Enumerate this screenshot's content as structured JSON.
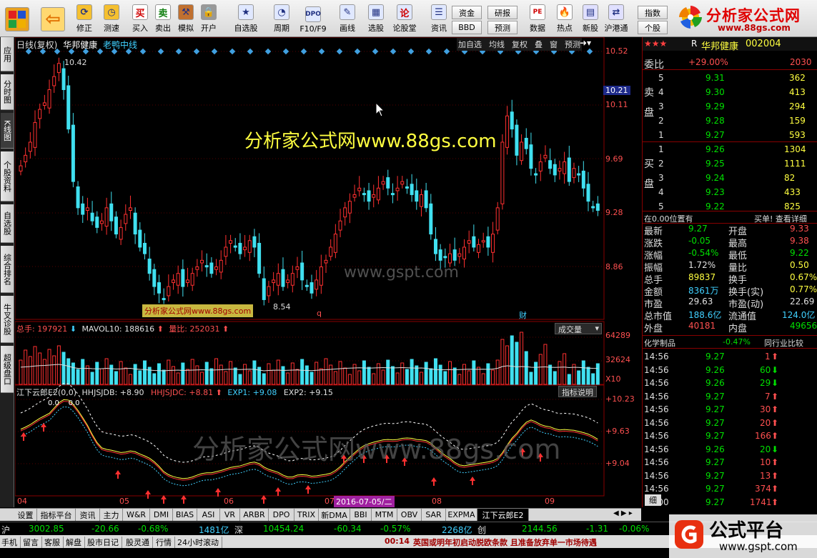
{
  "toolbar": {
    "buttons": [
      {
        "label": "",
        "icon": "grid-app-icon"
      },
      {
        "label": "",
        "icon": "back-arrow-icon"
      },
      {
        "label": "修正",
        "icon": "refresh-icon"
      },
      {
        "label": "测速",
        "icon": "clock-icon"
      },
      {
        "label": "买入",
        "icon": "buy-icon",
        "glyph": "买"
      },
      {
        "label": "卖出",
        "icon": "sell-icon",
        "glyph": "卖"
      },
      {
        "label": "模拟",
        "icon": "hammer-icon"
      },
      {
        "label": "开户",
        "icon": "lock-icon"
      },
      {
        "label": "自选股",
        "icon": "star-icon"
      },
      {
        "label": "周期",
        "icon": "cycle-icon"
      },
      {
        "label": "F10/F9",
        "icon": "f10-icon",
        "glyph": "DPO"
      },
      {
        "label": "画线",
        "icon": "pencil-icon"
      },
      {
        "label": "选股",
        "icon": "stock-pick-icon"
      },
      {
        "label": "论股堂",
        "icon": "forum-icon",
        "glyph": "论"
      },
      {
        "label": "资讯",
        "icon": "news-icon"
      },
      {
        "label": "数据",
        "icon": "pe-data-icon",
        "glyph": "PE"
      },
      {
        "label": "热点",
        "icon": "hot-icon"
      },
      {
        "label": "新股",
        "icon": "ipo-icon"
      },
      {
        "label": "沪港通",
        "icon": "sse-hkex-icon"
      }
    ],
    "small_buttons": [
      "资金",
      "研报",
      "BBD",
      "预测",
      "指数",
      "个股"
    ]
  },
  "logo": {
    "title": "分析家公式网",
    "url": "www.88gs.com"
  },
  "left_tabs": [
    "应用",
    "分时图",
    "K线图",
    "个股资料",
    "自选股",
    "综合排名",
    "牛叉诊股",
    "超级盘口"
  ],
  "chart": {
    "header": {
      "mode": "日线(复权)",
      "stock": "华邦健康",
      "indicator": "老鸭中线"
    },
    "header_buttons": [
      "加自选",
      "均线",
      "复权",
      "叠",
      "窗",
      "预测"
    ],
    "price_axis": [
      "10.52",
      "10.11",
      "9.69",
      "9.28",
      "8.86"
    ],
    "current_price_label": "10.21",
    "high_label": "10.42",
    "low_label": "8.54",
    "watermark_main": "分析家公式网www.88gs.com",
    "watermark_gspt": "www.gspt.com",
    "badge": "分析家公式网www.88gs.com",
    "marker_q": "q",
    "marker_cai": "财",
    "volume": {
      "total_label": "总手:",
      "total_value": "197921",
      "mavol_label": "MAVOL10:",
      "mavol_value": "188616",
      "ratio_label": "量比:",
      "ratio_value": "252031",
      "dropdown": "成交量",
      "axis": [
        "64289",
        "32624",
        "X10"
      ]
    },
    "indicator": {
      "name": "江下云郎E2(0,0)",
      "hh_label": "HHJSJDB:",
      "hh_value": "+8.90",
      "hhc_label": "HHJSJDC:",
      "hhc_value": "+8.81",
      "exp1_label": "EXP1:",
      "exp1_value": "+9.08",
      "exp2_label": "EXP2:",
      "exp2_value": "+9.15",
      "button": "指标说明",
      "axis": [
        "+10.23",
        "+9.63",
        "+9.04"
      ],
      "zero_labels": "0.0    0.0",
      "watermark": "分析家公式网www.88gs.com"
    },
    "dates": [
      "04",
      "05",
      "06",
      "07",
      "08",
      "09"
    ],
    "date_cursor": "2016-07-05/二"
  },
  "chart_data": {
    "type": "candlestick",
    "title": "华邦健康",
    "ylim": [
      8.45,
      10.6
    ],
    "x": [
      "04",
      "05",
      "06",
      "07",
      "08",
      "09"
    ],
    "series": [
      {
        "name": "price",
        "values": [
          9.62,
          9.7,
          9.8,
          9.95,
          10.05,
          10.1,
          10.2,
          10.3,
          10.4,
          10.2,
          9.9,
          9.5,
          9.3,
          9.25,
          9.3,
          9.2,
          9.15,
          9.2,
          9.3,
          9.2,
          9.1,
          9.15,
          9.25,
          9.3,
          9.1,
          9.0,
          8.95,
          8.8,
          8.7,
          8.65,
          8.6,
          8.7,
          8.75,
          8.8,
          8.7,
          8.75,
          8.8,
          8.85,
          8.9,
          8.85,
          8.8,
          8.85,
          8.9,
          9.0,
          9.05,
          9.0,
          8.95,
          9.0,
          9.05,
          9.0,
          8.8,
          8.6,
          8.7,
          8.75,
          8.8,
          8.7,
          8.75,
          8.8,
          8.85,
          8.75,
          8.7,
          8.65,
          8.75,
          8.85,
          8.9,
          9.0,
          9.1,
          9.2,
          9.3,
          9.35,
          9.4,
          9.45,
          9.4,
          9.35,
          9.4,
          9.45,
          9.5,
          9.45,
          9.4,
          9.45,
          9.5,
          9.45,
          9.4,
          9.35,
          9.4,
          9.3,
          9.1,
          8.95,
          8.9,
          8.92,
          8.95,
          8.9,
          8.95,
          9.0,
          9.05,
          9.0,
          9.02,
          9.05,
          9.0,
          9.1,
          9.3,
          9.8,
          10.0,
          9.9,
          9.7,
          9.8,
          9.75,
          9.6,
          9.55,
          9.65,
          9.7,
          9.6,
          9.55,
          9.6,
          9.65,
          9.5,
          9.6,
          9.55,
          9.45,
          9.35,
          9.3,
          9.28
        ]
      }
    ],
    "volume_axis": [
      64289,
      32624
    ],
    "price_ticks": [
      10.52,
      10.11,
      9.69,
      9.28,
      8.86
    ]
  },
  "right_panel": {
    "stars": "★★★",
    "r_label": "R",
    "stock_name": "华邦健康",
    "stock_code": "002004",
    "weibi_label": "委比",
    "weibi_value": "+29.00%",
    "weicha_value": "2030",
    "sell_label": "卖盘",
    "buy_label": "买盘",
    "asks": [
      {
        "level": "5",
        "price": "9.31",
        "vol": "362"
      },
      {
        "level": "4",
        "price": "9.30",
        "vol": "413"
      },
      {
        "level": "3",
        "price": "9.29",
        "vol": "294"
      },
      {
        "level": "2",
        "price": "9.28",
        "vol": "159"
      },
      {
        "level": "1",
        "price": "9.27",
        "vol": "593"
      }
    ],
    "bids": [
      {
        "level": "1",
        "price": "9.26",
        "vol": "1304"
      },
      {
        "level": "2",
        "price": "9.25",
        "vol": "1111"
      },
      {
        "level": "3",
        "price": "9.24",
        "vol": "82"
      },
      {
        "level": "4",
        "price": "9.23",
        "vol": "433"
      },
      {
        "level": "5",
        "price": "9.22",
        "vol": "825"
      }
    ],
    "position_note": "在0.00位置有",
    "position_right": "买单! 查看详细",
    "stats_left": [
      {
        "label": "最新",
        "value": "9.27",
        "color": "g"
      },
      {
        "label": "涨跌",
        "value": "-0.05",
        "color": "g"
      },
      {
        "label": "涨幅",
        "value": "-0.54%",
        "color": "g"
      },
      {
        "label": "振幅",
        "value": "1.72%",
        "color": "w"
      },
      {
        "label": "总手",
        "value": "89837",
        "color": "y"
      },
      {
        "label": "金额",
        "value": "8361万",
        "color": "c"
      },
      {
        "label": "市盈",
        "value": "29.63",
        "color": "w"
      },
      {
        "label": "总市值",
        "value": "188.6亿",
        "color": "c"
      },
      {
        "label": "外盘",
        "value": "40181",
        "color": "r"
      }
    ],
    "stats_right": [
      {
        "label": "开盘",
        "value": "9.33",
        "color": "r"
      },
      {
        "label": "最高",
        "value": "9.38",
        "color": "r"
      },
      {
        "label": "最低",
        "value": "9.22",
        "color": "g"
      },
      {
        "label": "量比",
        "value": "0.50",
        "color": "y"
      },
      {
        "label": "换手",
        "value": "0.67%",
        "color": "y"
      },
      {
        "label": "换手(实)",
        "value": "0.77%",
        "color": "y"
      },
      {
        "label": "市盈(动)",
        "value": "22.69",
        "color": "w"
      },
      {
        "label": "流通值",
        "value": "124.0亿",
        "color": "c"
      },
      {
        "label": "内盘",
        "value": "49656",
        "color": "g"
      }
    ],
    "industry": "化学制品",
    "industry_pct": "-0.47%",
    "industry_compare": "同行业比较",
    "ticks": [
      {
        "time": "14:56",
        "price": "9.27",
        "vol": "1",
        "dir": "up"
      },
      {
        "time": "14:56",
        "price": "9.26",
        "vol": "60",
        "dir": "down"
      },
      {
        "time": "14:56",
        "price": "9.26",
        "vol": "29",
        "dir": "down"
      },
      {
        "time": "14:56",
        "price": "9.27",
        "vol": "7",
        "dir": "up"
      },
      {
        "time": "14:56",
        "price": "9.27",
        "vol": "30",
        "dir": "up"
      },
      {
        "time": "14:56",
        "price": "9.27",
        "vol": "20",
        "dir": "up"
      },
      {
        "time": "14:56",
        "price": "9.27",
        "vol": "166",
        "dir": "up"
      },
      {
        "time": "14:56",
        "price": "9.26",
        "vol": "20",
        "dir": "down"
      },
      {
        "time": "14:56",
        "price": "9.27",
        "vol": "10",
        "dir": "up"
      },
      {
        "time": "14:56",
        "price": "9.27",
        "vol": "13",
        "dir": "up"
      },
      {
        "time": "14:56",
        "price": "9.27",
        "vol": "374",
        "dir": "up"
      },
      {
        "time": "15:00",
        "price": "9.27",
        "vol": "1741",
        "dir": "up"
      }
    ],
    "tick_tab": "细"
  },
  "bottom_tabs": [
    "设置",
    "指标平台",
    "资讯",
    "主力",
    "W&R",
    "DMI",
    "BIAS",
    "ASI",
    "VR",
    "ARBR",
    "DPO",
    "TRIX",
    "新DMA",
    "BBI",
    "MTM",
    "OBV",
    "SAR",
    "EXPMA",
    "江下云郎E2"
  ],
  "status": {
    "sh_label": "沪",
    "sh_index": "3002.85",
    "sh_change": "-20.66",
    "sh_pct": "-0.68%",
    "sh_amount": "1481亿",
    "sz_label": "深",
    "sz_index": "10454.24",
    "sz_change": "-60.34",
    "sz_pct": "-0.57%",
    "sz_amount": "2268亿",
    "cy_label": "创",
    "cy_index": "2144.56",
    "cy_change": "-1.31",
    "cy_pct": "-0.06%",
    "bottom_items": [
      "手机",
      "留言",
      "客服",
      "解盘",
      "股市日记",
      "股灵通",
      "行情",
      "24小时滚动"
    ],
    "news_time": "00:14",
    "news_text": "英国或明年初启动脱欧条款 且准备放弃单一市场待遇"
  },
  "gspt": {
    "title": "公式平台",
    "url": "www.gspt.com"
  }
}
